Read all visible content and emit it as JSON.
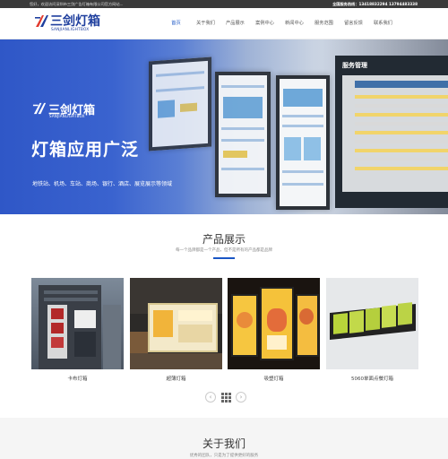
{
  "topbar": {
    "welcome": "您好，欢迎访问深圳市三剑广告灯箱有限公司官方网站...",
    "hotline_label": "全国服务热线：",
    "hotline": "13418832294  13794483338"
  },
  "logo": {
    "name": "三剑灯箱",
    "en": "SANJIANLIGHTBOX"
  },
  "nav": {
    "items": [
      "首页",
      "关于我们",
      "产品展示",
      "案例中心",
      "新闻中心",
      "服务范围",
      "留言反馈",
      "联系我们"
    ]
  },
  "banner": {
    "logo_name": "三剑灯箱",
    "logo_en": "SANJIANLIGHTBOX",
    "headline": "灯箱应用广泛",
    "subline": "地铁站、机场、车站、商场、银行、酒店、展览展示等领域",
    "board_title": "服务管理"
  },
  "products": {
    "title": "产品展示",
    "subtitle": "每一个品牌都是一个产品，但不是所有的产品都是品牌",
    "items": [
      {
        "label": "卡布灯箱"
      },
      {
        "label": "超薄灯箱"
      },
      {
        "label": "吸塑灯箱"
      },
      {
        "label": "5060单面点餐灯箱"
      }
    ]
  },
  "about": {
    "title": "关于我们",
    "subtitle": "优秀的团队，只是为了提供更好的服务"
  },
  "colors": {
    "accent": "#1a56c5",
    "brand": "#1f3f9e",
    "topbar": "#3a3a3a"
  }
}
